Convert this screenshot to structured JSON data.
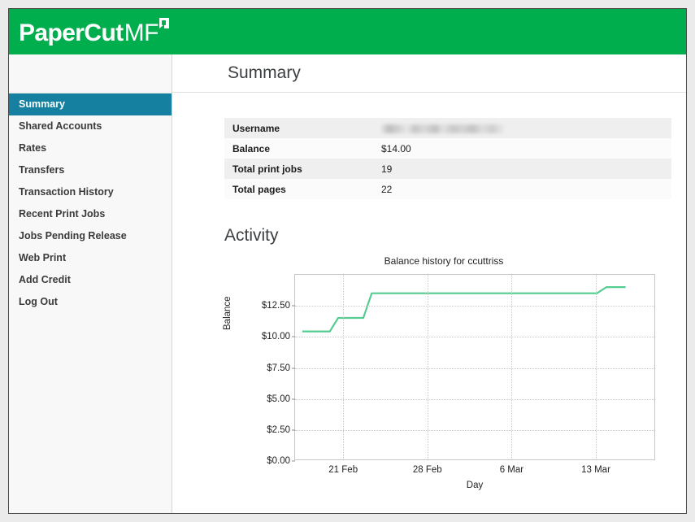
{
  "app": {
    "logo_main": "PaperCut",
    "logo_sub": "MF",
    "header_color": "#00ae4d",
    "accent_color": "#15809f"
  },
  "sidebar": {
    "items": [
      {
        "label": "Summary",
        "active": true
      },
      {
        "label": "Shared Accounts",
        "active": false
      },
      {
        "label": "Rates",
        "active": false
      },
      {
        "label": "Transfers",
        "active": false
      },
      {
        "label": "Transaction History",
        "active": false
      },
      {
        "label": "Recent Print Jobs",
        "active": false
      },
      {
        "label": "Jobs Pending Release",
        "active": false
      },
      {
        "label": "Web Print",
        "active": false
      },
      {
        "label": "Add Credit",
        "active": false
      },
      {
        "label": "Log Out",
        "active": false
      }
    ]
  },
  "main": {
    "page_title": "Summary",
    "activity_title": "Activity",
    "summary_rows": [
      {
        "label": "Username",
        "value": "",
        "redacted": true
      },
      {
        "label": "Balance",
        "value": "$14.00",
        "redacted": false
      },
      {
        "label": "Total print jobs",
        "value": "19",
        "redacted": false
      },
      {
        "label": "Total pages",
        "value": "22",
        "redacted": false
      }
    ]
  },
  "chart_data": {
    "type": "line",
    "title": "Balance history for ccuttriss",
    "xlabel": "Day",
    "ylabel": "Balance",
    "ylim": [
      0,
      15
    ],
    "yticks": [
      0,
      2.5,
      5,
      7.5,
      10,
      12.5
    ],
    "ytick_labels": [
      "$0.00",
      "$2.50",
      "$5.00",
      "$7.50",
      "$10.00",
      "$12.50"
    ],
    "xlim": [
      17,
      47
    ],
    "xticks": [
      21,
      28,
      35,
      42
    ],
    "xtick_labels": [
      "21 Feb",
      "28 Feb",
      "6 Mar",
      "13 Mar"
    ],
    "grid": true,
    "legend": "none",
    "line_color": "#55cc90",
    "series": [
      {
        "name": "Balance",
        "x": [
          17.6,
          19.9,
          20.6,
          22.7,
          23.4,
          28.0,
          34.0,
          41.0,
          42.2,
          43.0,
          44.6
        ],
        "y": [
          10.4,
          10.4,
          11.5,
          11.5,
          13.5,
          13.5,
          13.5,
          13.5,
          13.5,
          14.0,
          14.0
        ]
      }
    ]
  }
}
